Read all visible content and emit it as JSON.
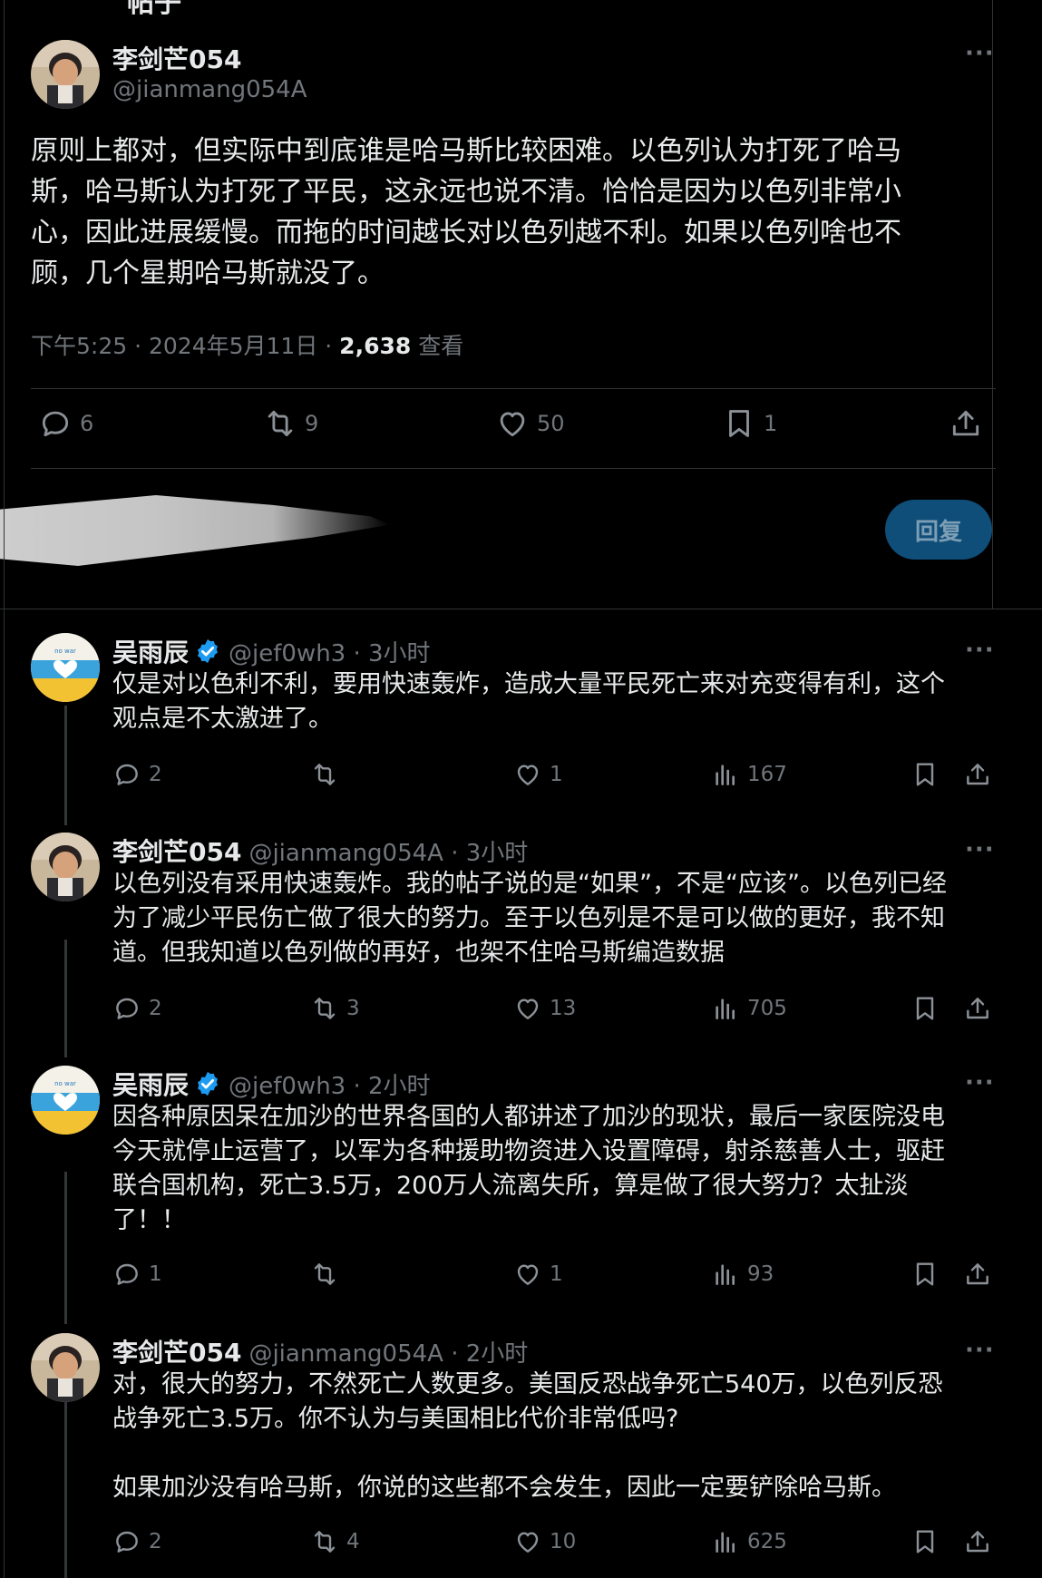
{
  "header": {
    "partial_title": "帖子"
  },
  "main_tweet": {
    "author_name": "李剑芒054",
    "author_handle": "@jianmang054A",
    "text_lines": [
      "原则上都对，但实际中到底谁是哈马斯比较困难。以色列认为打死了哈马",
      "斯，哈马斯认为打死了平民，这永远也说不清。恰恰是因为以色列非常小",
      "心，因此进展缓慢。而拖的时间越长对以色列越不利。如果以色列啥也不",
      "顾，几个星期哈马斯就没了。"
    ],
    "time": "下午5:25 · 2024年5月11日 · ",
    "views_count": "2,638",
    "views_label": " 查看",
    "stats": {
      "replies": "6",
      "retweets": "9",
      "likes": "50",
      "bookmarks": "1"
    },
    "more": "···"
  },
  "reply_box": {
    "button_label": "回复"
  },
  "replies": [
    {
      "name": "吴雨辰",
      "handle": "@jef0wh3 · 3小时",
      "verified": true,
      "text_lines": [
        "仅是对以色利不利，要用快速轰炸，造成大量平民死亡来对充变得有利，这个",
        "观点是不太激进了。"
      ],
      "stats": {
        "replies": "2",
        "retweets": "",
        "likes": "1",
        "views": "167"
      },
      "more": "···"
    },
    {
      "name": "李剑芒054",
      "handle": "@jianmang054A · 3小时",
      "verified": false,
      "text_lines": [
        "以色列没有采用快速轰炸。我的帖子说的是“如果”，不是“应该”。以色列已经",
        "为了减少平民伤亡做了很大的努力。至于以色列是不是可以做的更好，我不知",
        "道。但我知道以色列做的再好，也架不住哈马斯编造数据"
      ],
      "stats": {
        "replies": "2",
        "retweets": "3",
        "likes": "13",
        "views": "705"
      },
      "more": "···"
    },
    {
      "name": "吴雨辰",
      "handle": "@jef0wh3 · 2小时",
      "verified": true,
      "text_lines": [
        "因各种原因呆在加沙的世界各国的人都讲述了加沙的现状，最后一家医院没电",
        "今天就停止运营了，以军为各种援助物资进入设置障碍，射杀慈善人士，驱赶",
        "联合国机构，死亡3.5万，200万人流离失所，算是做了很大努力？太扯淡",
        "了！！"
      ],
      "stats": {
        "replies": "1",
        "retweets": "",
        "likes": "1",
        "views": "93"
      },
      "more": "···"
    },
    {
      "name": "李剑芒054",
      "handle": "@jianmang054A · 2小时",
      "verified": false,
      "text_lines": [
        "对，很大的努力，不然死亡人数更多。美国反恐战争死亡540万，以色列反恐",
        "战争死亡3.5万。你不认为与美国相比代价非常低吗?",
        "",
        "如果加沙没有哈马斯，你说的这些都不会发生，因此一定要铲除哈马斯。"
      ],
      "stats": {
        "replies": "2",
        "retweets": "4",
        "likes": "10",
        "views": "625"
      },
      "more": "···"
    }
  ],
  "avatar_badge_text": "no war",
  "colors": {
    "background": "#000000",
    "text": "#e7e9ea",
    "muted": "#71767b",
    "accent": "#1d9bf0",
    "reply_button": "#0f4e78"
  }
}
